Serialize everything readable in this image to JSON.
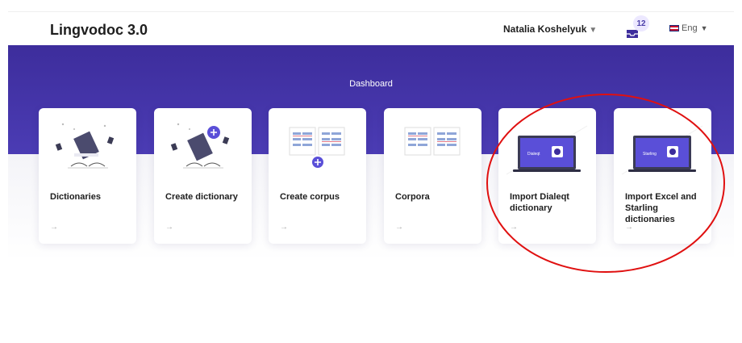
{
  "app": {
    "title": "Lingvodoc 3.0"
  },
  "header": {
    "user_name": "Natalia Koshelyuk",
    "notifications_count": "12",
    "language": "Eng"
  },
  "banner": {
    "title": "Dashboard"
  },
  "cards": [
    {
      "label": "Dictionaries",
      "icon": "dictionaries-illustration"
    },
    {
      "label": "Create dictionary",
      "icon": "create-dictionary-illustration"
    },
    {
      "label": "Create corpus",
      "icon": "create-corpus-illustration"
    },
    {
      "label": "Corpora",
      "icon": "corpora-illustration"
    },
    {
      "label": "Import Dialeqt dictionary",
      "icon": "laptop-illustration",
      "screen_text": "Dialeqt"
    },
    {
      "label": "Import Excel and Starling dictionaries",
      "icon": "laptop-illustration",
      "screen_text": "Starling"
    }
  ],
  "arrow_glyph": "→",
  "colors": {
    "banner": "#4030a8",
    "accent": "#5a4fd8",
    "annotation": "#e01010"
  }
}
